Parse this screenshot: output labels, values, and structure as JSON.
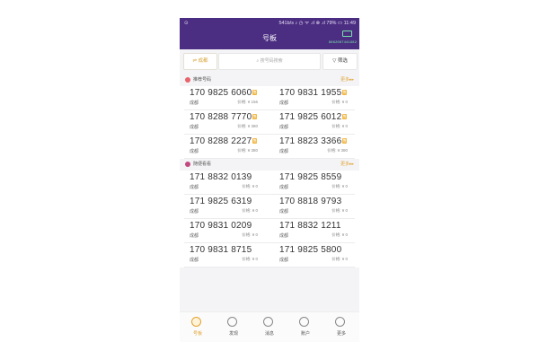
{
  "status_bar": {
    "left": "⊙",
    "right": "541b/s ♪ ◷ ᯤ .ıl ⊗ .ıl 79% ▭ 11:49"
  },
  "header": {
    "title": "号板",
    "scanner_icon": "scan-icon",
    "phone_id": "8862087441982"
  },
  "filters": {
    "city": "⇌ 成都",
    "search_placeholder": "⌕ 搜号码搜索",
    "filter": "▽ 筛选"
  },
  "sections": [
    {
      "title": "推荐号码",
      "more": "更多▸▸",
      "dot_color": "#e8636d",
      "rows": [
        [
          {
            "number": "170 9825 6060",
            "tag": "售",
            "city": "成都",
            "price": "价格: ¥ 156"
          },
          {
            "number": "170 9831 1955",
            "tag": "售",
            "city": "成都",
            "price": "价格: ¥ 0"
          }
        ],
        [
          {
            "number": "170 8288 7770",
            "tag": "售",
            "city": "成都",
            "price": "价格: ¥ 380"
          },
          {
            "number": "171 9825 6012",
            "tag": "售",
            "city": "成都",
            "price": "价格: ¥ 0"
          }
        ],
        [
          {
            "number": "170 8288 2227",
            "tag": "售",
            "city": "成都",
            "price": "价格: ¥ 380"
          },
          {
            "number": "171 8823 3366",
            "tag": "售",
            "city": "成都",
            "price": "价格: ¥ 380"
          }
        ]
      ]
    },
    {
      "title": "随便看看",
      "more": "更多▸▸",
      "dot_color": "#c2497f",
      "rows": [
        [
          {
            "number": "171 8832 0139",
            "tag": "",
            "city": "成都",
            "price": "价格: ¥ 0"
          },
          {
            "number": "171 9825 8559",
            "tag": "",
            "city": "成都",
            "price": "价格: ¥ 0"
          }
        ],
        [
          {
            "number": "171 9825 6319",
            "tag": "",
            "city": "成都",
            "price": "价格: ¥ 0"
          },
          {
            "number": "170 8818 9793",
            "tag": "",
            "city": "成都",
            "price": "价格: ¥ 0"
          }
        ],
        [
          {
            "number": "170 9831 0209",
            "tag": "",
            "city": "成都",
            "price": "价格: ¥ 0"
          },
          {
            "number": "171 8832 1211",
            "tag": "",
            "city": "成都",
            "price": "价格: ¥ 0"
          }
        ],
        [
          {
            "number": "170 9831 8715",
            "tag": "",
            "city": "成都",
            "price": "价格: ¥ 0"
          },
          {
            "number": "171 9825 5800",
            "tag": "",
            "city": "成都",
            "price": "价格: ¥ 0"
          }
        ]
      ]
    }
  ],
  "tabs": [
    {
      "label": "号板",
      "icon": "board-icon",
      "active": true
    },
    {
      "label": "发现",
      "icon": "compass-icon",
      "active": false
    },
    {
      "label": "消息",
      "icon": "message-icon",
      "active": false
    },
    {
      "label": "账户",
      "icon": "account-icon",
      "active": false
    },
    {
      "label": "更多",
      "icon": "more-icon",
      "active": false
    }
  ],
  "colors": {
    "header_bg": "#4b2d82",
    "accent": "#e2a332",
    "tag_bg": "#f0b43c"
  }
}
